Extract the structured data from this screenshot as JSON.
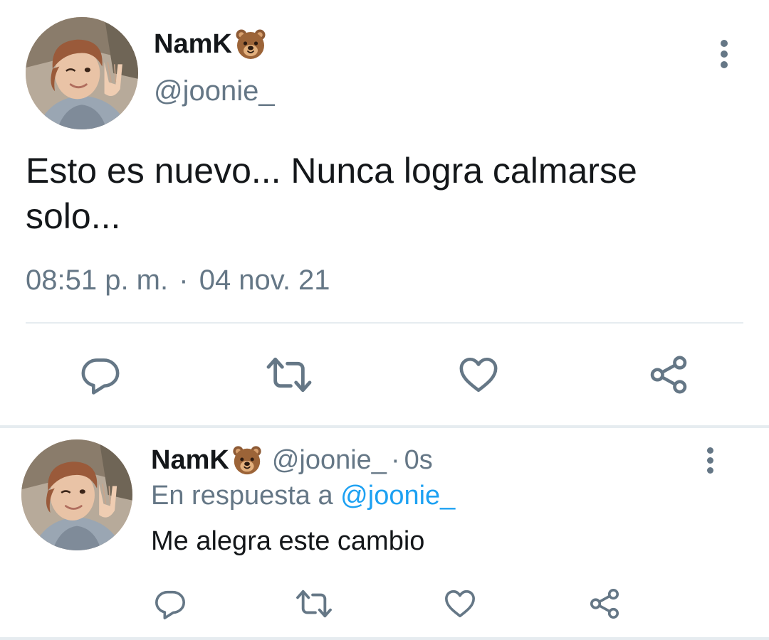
{
  "main_tweet": {
    "display_name": "NamK",
    "name_emoji": "bear-face-emoji",
    "handle": "@joonie_",
    "text": "Esto es nuevo... Nunca logra calmarse solo...",
    "time": "08:51 p. m.",
    "separator": "·",
    "date": "04 nov. 21",
    "actions": [
      "reply-icon",
      "retweet-icon",
      "like-icon",
      "share-icon"
    ]
  },
  "reply_tweet": {
    "display_name": "NamK",
    "name_emoji": "bear-face-emoji",
    "handle": "@joonie_",
    "separator": "·",
    "time_ago": "0s",
    "in_reply_prefix": "En respuesta a",
    "in_reply_handle": "@joonie_",
    "text": "Me alegra este cambio",
    "actions": [
      "reply-icon",
      "retweet-icon",
      "like-icon",
      "share-icon"
    ]
  },
  "colors": {
    "text_primary": "#14171a",
    "text_secondary": "#657786",
    "link": "#1da1f2",
    "divider": "#e6ecf0"
  }
}
